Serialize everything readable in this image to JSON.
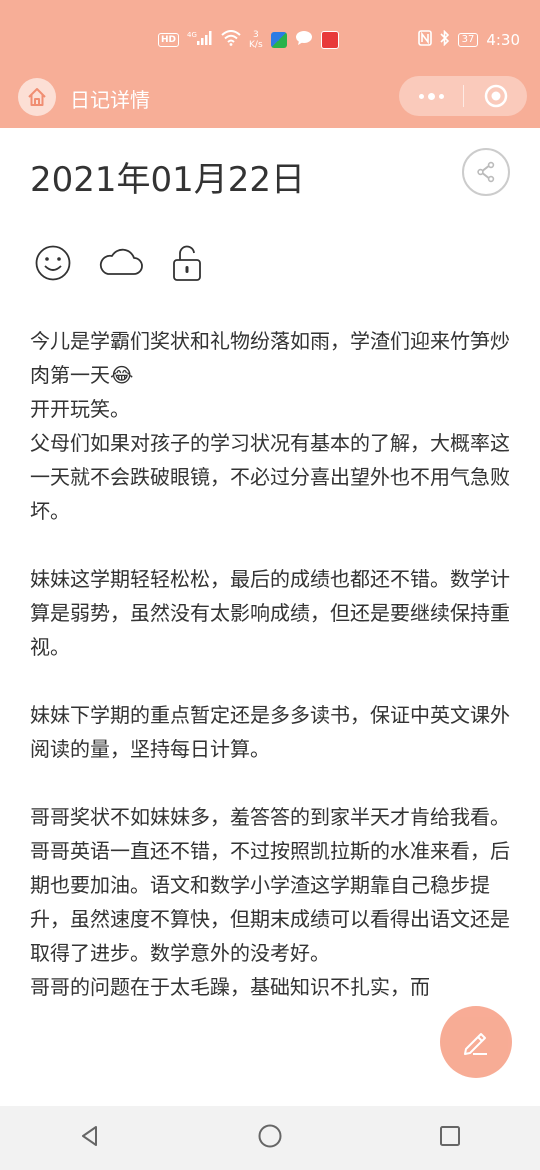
{
  "status_bar": {
    "hd_label": "HD",
    "signal_label": "4G",
    "net_speed_value": "3",
    "net_speed_unit": "K/s",
    "battery_level": "37",
    "time": "4:30"
  },
  "nav": {
    "title": "日记详情"
  },
  "diary": {
    "date": "2021年01月22日",
    "mood_icon": "smile-icon",
    "weather_icon": "cloud-icon",
    "privacy_icon": "unlock-icon",
    "paragraphs": [
      "今儿是学霸们奖状和礼物纷落如雨，学渣们迎来竹笋炒肉第一天😂",
      "开开玩笑。",
      "父母们如果对孩子的学习状况有基本的了解，大概率这一天就不会跌破眼镜，不必过分喜出望外也不用气急败坏。",
      "",
      "妹妹这学期轻轻松松，最后的成绩也都还不错。数学计算是弱势，虽然没有太影响成绩，但还是要继续保持重视。",
      "",
      "妹妹下学期的重点暂定还是多多读书，保证中英文课外阅读的量，坚持每日计算。",
      "",
      "哥哥奖状不如妹妹多，羞答答的到家半天才肯给我看。",
      "哥哥英语一直还不错，不过按照凯拉斯的水准来看，后期也要加油。语文和数学小学渣这学期靠自己稳步提升，虽然速度不算快，但期末成绩可以看得出语文还是取得了进步。数学意外的没考好。",
      "哥哥的问题在于太毛躁，基础知识不扎实，而"
    ]
  },
  "colors": {
    "header": "#f7ae97",
    "fab": "#f7a58d",
    "text": "#333333"
  }
}
